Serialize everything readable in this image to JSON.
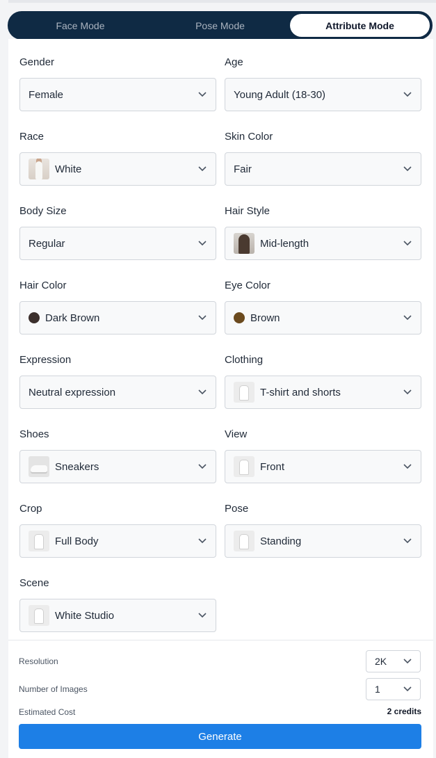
{
  "modes": {
    "tabs": [
      {
        "label": "Face Mode",
        "active": false
      },
      {
        "label": "Pose Mode",
        "active": false
      },
      {
        "label": "Attribute Mode",
        "active": true
      }
    ]
  },
  "attributes": {
    "gender": {
      "label": "Gender",
      "value": "Female"
    },
    "age": {
      "label": "Age",
      "value": "Young Adult (18-30)"
    },
    "race": {
      "label": "Race",
      "value": "White",
      "icon": "portrait-thumbnail-icon"
    },
    "skin_color": {
      "label": "Skin Color",
      "value": "Fair"
    },
    "body_size": {
      "label": "Body Size",
      "value": "Regular"
    },
    "hair_style": {
      "label": "Hair Style",
      "value": "Mid-length",
      "icon": "hairstyle-thumbnail-icon"
    },
    "hair_color": {
      "label": "Hair Color",
      "value": "Dark Brown",
      "swatch": "#3b2f2c"
    },
    "eye_color": {
      "label": "Eye Color",
      "value": "Brown",
      "swatch": "#6b4a1e"
    },
    "expression": {
      "label": "Expression",
      "value": "Neutral expression"
    },
    "clothing": {
      "label": "Clothing",
      "value": "T-shirt and shorts",
      "icon": "clothing-thumbnail-icon"
    },
    "shoes": {
      "label": "Shoes",
      "value": "Sneakers",
      "icon": "sneaker-thumbnail-icon"
    },
    "view": {
      "label": "View",
      "value": "Front",
      "icon": "view-thumbnail-icon"
    },
    "crop": {
      "label": "Crop",
      "value": "Full Body",
      "icon": "crop-thumbnail-icon"
    },
    "pose": {
      "label": "Pose",
      "value": "Standing",
      "icon": "pose-thumbnail-icon"
    },
    "scene": {
      "label": "Scene",
      "value": "White Studio",
      "icon": "scene-thumbnail-icon"
    }
  },
  "settings": {
    "resolution": {
      "label": "Resolution",
      "value": "2K"
    },
    "num_images": {
      "label": "Number of Images",
      "value": "1"
    },
    "cost": {
      "label": "Estimated Cost",
      "value": "2 credits"
    },
    "generate_label": "Generate"
  },
  "colors": {
    "tab_bar": "#0f2a44",
    "primary": "#1d7fe6"
  }
}
